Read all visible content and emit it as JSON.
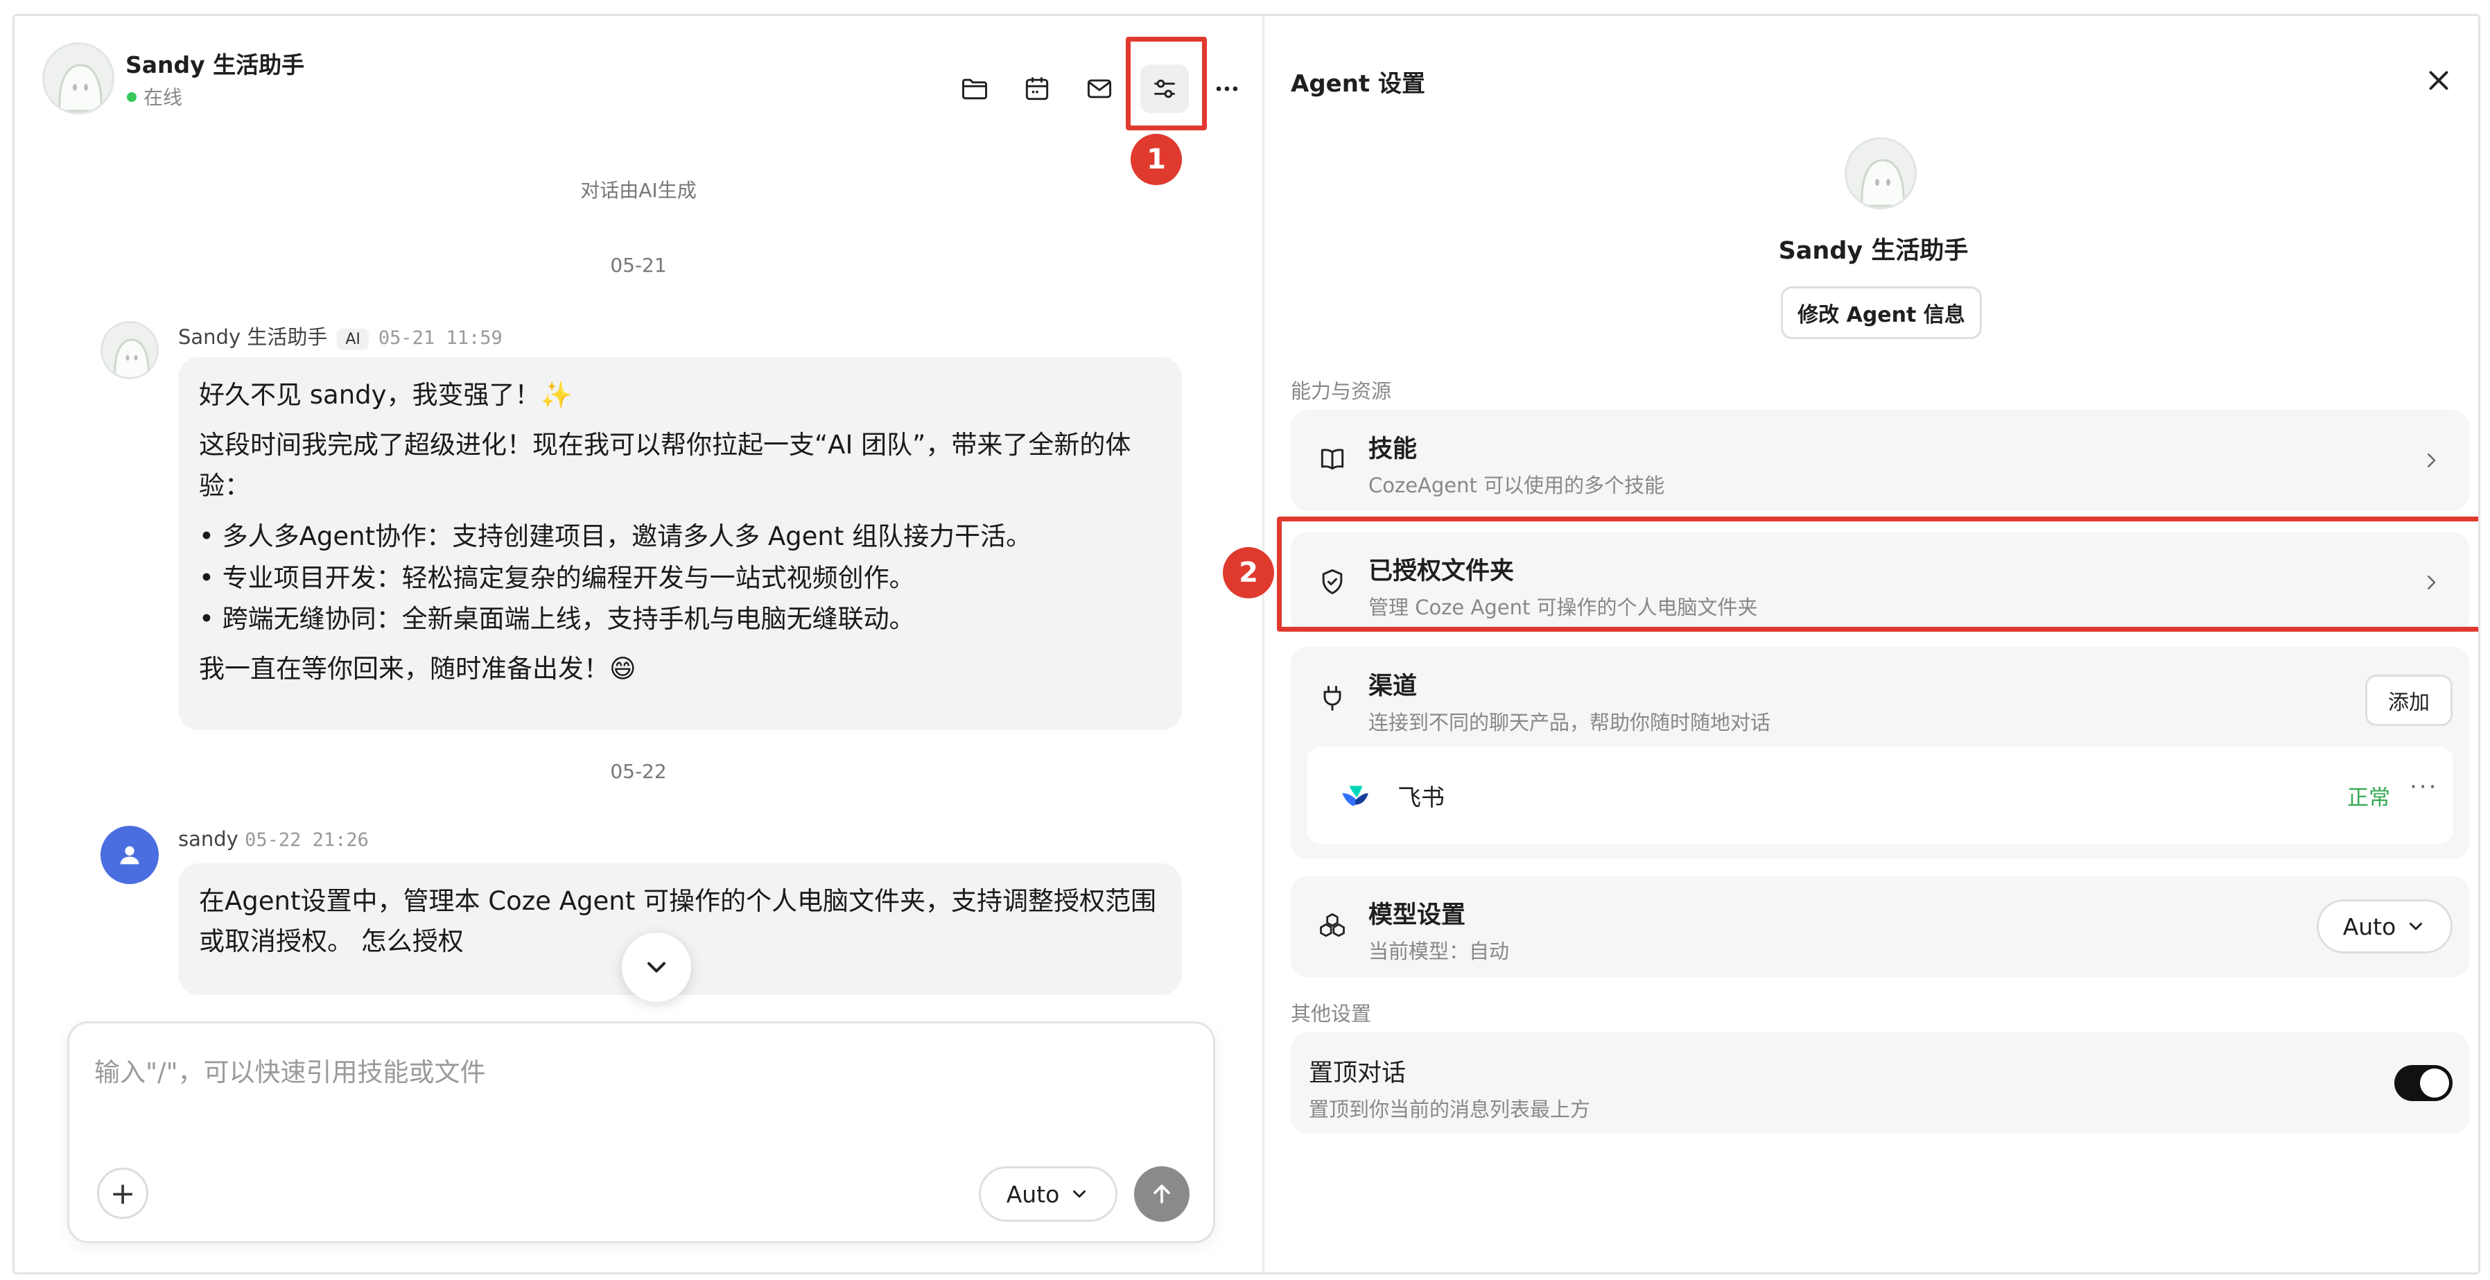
{
  "chat": {
    "agent_name": "Sandy 生活助手",
    "status": "在线",
    "ai_notice": "对话由AI生成",
    "dates": [
      "05-21",
      "05-22"
    ],
    "messages": [
      {
        "sender": "Sandy 生活助手",
        "ai_badge": "AI",
        "time": "05-21 11:59",
        "lines": [
          "好久不见 sandy，我变强了！✨",
          "这段时间我完成了超级进化！现在我可以帮你拉起一支“AI 团队”，带来了全新的体验：",
          "• 多人多Agent协作：支持创建项目，邀请多人多 Agent 组队接力干活。",
          "• 专业项目开发：轻松搞定复杂的编程开发与一站式视频创作。",
          "• 跨端无缝协同：全新桌面端上线，支持手机与电脑无缝联动。",
          "我一直在等你回来，随时准备出发！😄"
        ]
      },
      {
        "sender": "sandy",
        "time": "05-22 21:26",
        "text": "在Agent设置中，管理本 Coze Agent 可操作的个人电脑文件夹，支持调整授权范围或取消授权。 怎么授权"
      }
    ],
    "input_placeholder": "输入\"/\"，可以快速引用技能或文件",
    "model_value": "Auto"
  },
  "toolbar": {
    "icons": [
      "folder-icon",
      "calendar-icon",
      "mail-icon",
      "settings-sliders-icon",
      "more-icon"
    ]
  },
  "annotations": {
    "marker_1": "1",
    "marker_2": "2",
    "color": "#e03a2f"
  },
  "settings": {
    "title": "Agent 设置",
    "agent_name": "Sandy 生活助手",
    "edit_button": "修改 Agent 信息",
    "section_resources": "能力与资源",
    "skills": {
      "title": "技能",
      "subtitle": "CozeAgent 可以使用的多个技能"
    },
    "folders": {
      "title": "已授权文件夹",
      "subtitle": "管理 Coze Agent 可操作的个人电脑文件夹"
    },
    "channels": {
      "title": "渠道",
      "subtitle": "连接到不同的聊天产品，帮助你随时随地对话",
      "add_button": "添加",
      "items": [
        {
          "name": "飞书",
          "status": "正常"
        }
      ]
    },
    "model": {
      "title": "模型设置",
      "subtitle": "当前模型：自动",
      "value": "Auto"
    },
    "section_other": "其他设置",
    "pin": {
      "title": "置顶对话",
      "subtitle": "置顶到你当前的消息列表最上方",
      "enabled": true
    }
  }
}
